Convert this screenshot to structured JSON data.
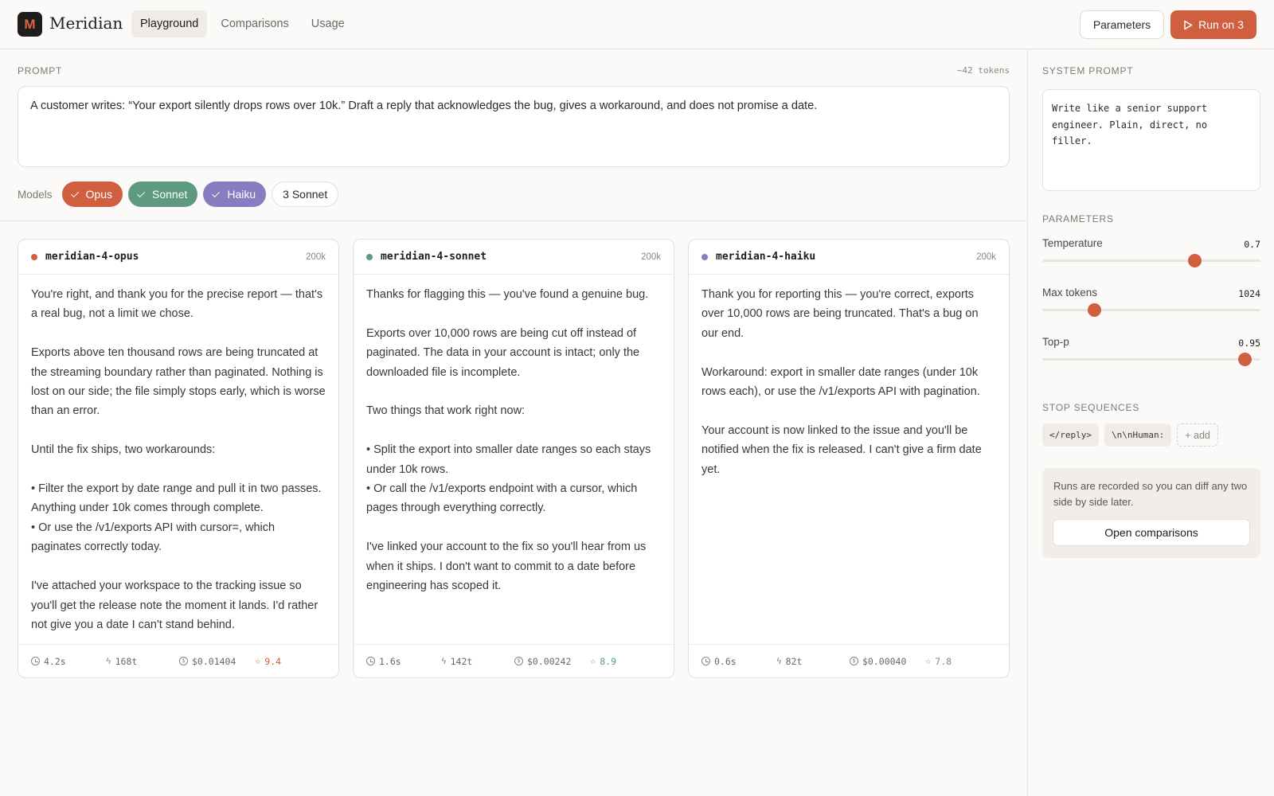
{
  "app": {
    "logo_letter": "M",
    "name": "Meridian"
  },
  "nav": [
    {
      "label": "Playground",
      "active": true
    },
    {
      "label": "Comparisons",
      "active": false
    },
    {
      "label": "Usage",
      "active": false
    }
  ],
  "header_actions": {
    "parameters_label": "Parameters",
    "run_label": "Run on 3"
  },
  "prompt": {
    "label": "PROMPT",
    "token_count": "~42 tokens",
    "text": "A customer writes: “Your export silently drops rows over 10k.” Draft a reply that acknowledges the bug, gives a workaround, and does not promise a date."
  },
  "models": {
    "label": "Models",
    "chips": [
      {
        "label": "Opus",
        "selected": true,
        "color": "#cf5f3f"
      },
      {
        "label": "Sonnet",
        "selected": true,
        "color": "#5e9a82"
      },
      {
        "label": "Haiku",
        "selected": true,
        "color": "#8a7cc0"
      },
      {
        "label": "3 Sonnet",
        "selected": false,
        "color": "#ffffff"
      }
    ]
  },
  "cards": [
    {
      "model": "meridian-4-opus",
      "dot_color": "#cf5f3f",
      "context": "200k",
      "response": "You're right, and thank you for the precise report — that's a real bug, not a limit we chose.\n\nExports above ten thousand rows are being truncated at the streaming boundary rather than paginated. Nothing is lost on our side; the file simply stops early, which is worse than an error.\n\nUntil the fix ships, two workarounds:\n\n• Filter the export by date range and pull it in two passes. Anything under 10k comes through complete.\n• Or use the /v1/exports API with cursor=, which paginates correctly today.\n\nI've attached your workspace to the tracking issue so you'll get the release note the moment it lands. I'd rather not give you a date I can't stand behind.",
      "stats": {
        "time": "4.2s",
        "tokens": "168t",
        "cost": "$0.01404",
        "score": "9.4",
        "score_color": "#cf5f3f"
      }
    },
    {
      "model": "meridian-4-sonnet",
      "dot_color": "#5e9a82",
      "context": "200k",
      "response": "Thanks for flagging this — you've found a genuine bug.\n\nExports over 10,000 rows are being cut off instead of paginated. The data in your account is intact; only the downloaded file is incomplete.\n\nTwo things that work right now:\n\n• Split the export into smaller date ranges so each stays under 10k rows.\n• Or call the /v1/exports endpoint with a cursor, which pages through everything correctly.\n\nI've linked your account to the fix so you'll hear from us when it ships. I don't want to commit to a date before engineering has scoped it.",
      "stats": {
        "time": "1.6s",
        "tokens": "142t",
        "cost": "$0.00242",
        "score": "8.9",
        "score_color": "#5e9a82"
      }
    },
    {
      "model": "meridian-4-haiku",
      "dot_color": "#8a7cc0",
      "context": "200k",
      "response": "Thank you for reporting this — you're correct, exports over 10,000 rows are being truncated. That's a bug on our end.\n\nWorkaround: export in smaller date ranges (under 10k rows each), or use the /v1/exports API with pagination.\n\nYour account is now linked to the issue and you'll be notified when the fix is released. I can't give a firm date yet.",
      "stats": {
        "time": "0.6s",
        "tokens": "82t",
        "cost": "$0.00040",
        "score": "7.8",
        "score_color": "#8a8680"
      }
    }
  ],
  "sidebar": {
    "system_prompt_label": "SYSTEM PROMPT",
    "system_prompt": "Write like a senior support engineer. Plain, direct, no filler.",
    "parameters_label": "PARAMETERS",
    "params": [
      {
        "name": "Temperature",
        "value": "0.7",
        "fraction": 0.7
      },
      {
        "name": "Max tokens",
        "value": "1024",
        "fraction": 0.24
      },
      {
        "name": "Top-p",
        "value": "0.95",
        "fraction": 0.93
      }
    ],
    "stop_label": "STOP SEQUENCES",
    "stop_sequences": [
      "</reply>",
      "\\n\\nHuman:"
    ],
    "stop_add_label": "+ add",
    "note_text": "Runs are recorded so you can diff any two side by side later.",
    "note_button": "Open comparisons"
  }
}
